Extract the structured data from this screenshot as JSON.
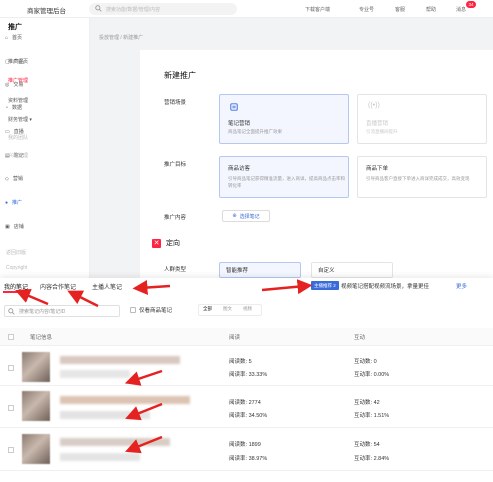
{
  "topbar": {
    "brand": "商家管理后台",
    "search_placeholder": "搜索功能/数据/管理/内容",
    "links": [
      "下载客户端",
      "专业号",
      "客服",
      "帮助",
      "消息"
    ],
    "notify_count": "34"
  },
  "sidebar": {
    "items": [
      {
        "label": "首页",
        "icon": "home-icon"
      },
      {
        "label": "商品",
        "icon": "bag-icon"
      },
      {
        "label": "交易",
        "icon": "trade-icon"
      },
      {
        "label": "数据",
        "icon": "chart-icon"
      },
      {
        "label": "直播",
        "icon": "live-icon"
      },
      {
        "label": "笔记",
        "icon": "note-icon"
      },
      {
        "label": "营销",
        "icon": "marketing-icon"
      },
      {
        "label": "推广",
        "icon": "promote-icon"
      },
      {
        "label": "店铺",
        "icon": "store-icon"
      }
    ],
    "footer": [
      "返回旧版",
      "Copyright"
    ]
  },
  "subnav": {
    "title": "推广",
    "items": [
      "推广首页",
      "推广管理",
      "资料管理",
      "财务管理 ▾",
      "我的团队",
      "兴趣管理"
    ]
  },
  "breadcrumb": "投放管理 / 新建推广",
  "form": {
    "title": "新建推广",
    "scene_label": "营销场景",
    "scene_options": [
      {
        "title": "笔记营销",
        "desc": "商品笔记全面提升推广效果"
      },
      {
        "title": "直播营销",
        "desc": "引流直播间提升"
      }
    ],
    "goal_label": "推广目标",
    "goal_options": [
      {
        "title": "商品访客",
        "desc": "引导商品笔记获得精准流量，进入商详，提高商品点击率和转化率"
      },
      {
        "title": "商品下单",
        "desc": "引导商品客户直接下单进入商详完成成交，高效变现"
      }
    ],
    "content_label": "推广内容",
    "add_note": "选择笔记",
    "targeting_title": "定向",
    "crowd_label": "人群类型",
    "crowd_options": [
      "智能推荐",
      "自定义"
    ]
  },
  "drawer": {
    "tabs": [
      "我的笔记",
      "内容合作笔记",
      "主播人笔记"
    ],
    "tip_tag": "主播推荐 2",
    "tip_text": "视频笔记搭配视频流场景，拿量更佳",
    "tip_more": "更多",
    "search_placeholder": "搜索笔记内容/笔记ID",
    "only_goods": "仅看商品笔记",
    "segments": [
      "全部",
      "图文",
      "视频"
    ],
    "columns": [
      "笔记信息",
      "阅读",
      "互动"
    ],
    "rows": [
      {
        "read_count_label": "阅读数:",
        "read_count": "5",
        "read_rate_label": "阅读率:",
        "read_rate": "33.33%",
        "inter_count_label": "互动数:",
        "inter_count": "0",
        "inter_rate_label": "互动率:",
        "inter_rate": "0.00%"
      },
      {
        "read_count_label": "阅读数:",
        "read_count": "2774",
        "read_rate_label": "阅读率:",
        "read_rate": "34.50%",
        "inter_count_label": "互动数:",
        "inter_count": "42",
        "inter_rate_label": "互动率:",
        "inter_rate": "1.51%"
      },
      {
        "read_count_label": "阅读数:",
        "read_count": "1899",
        "read_rate_label": "阅读率:",
        "read_rate": "38.97%",
        "inter_count_label": "互动数:",
        "inter_count": "54",
        "inter_rate_label": "互动率:",
        "inter_rate": "2.84%"
      }
    ]
  },
  "colors": {
    "accent": "#ff2442",
    "link": "#3a6bdb"
  }
}
